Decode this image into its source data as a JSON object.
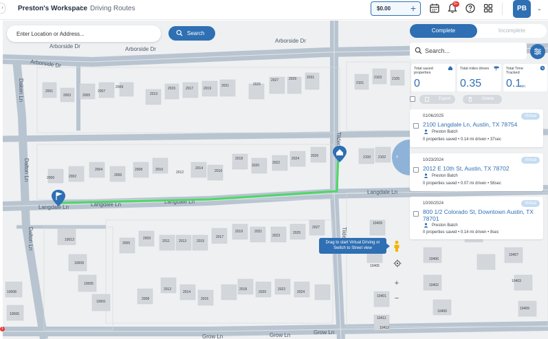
{
  "header": {
    "workspace": "Preston's Workspace",
    "separator": ">",
    "page": "Driving Routes",
    "balance": "$0.00",
    "notification_badge": "9+",
    "avatar_initials": "PB"
  },
  "search": {
    "placeholder": "Enter Location or Address...",
    "button_label": "Search"
  },
  "panel": {
    "tabs": [
      "Complete",
      "Incomplete"
    ],
    "active_tab": "Complete",
    "search_placeholder": "Search...",
    "stats": [
      {
        "label": "Total saved properties",
        "value": "0",
        "unit": "",
        "icon": "home-icon"
      },
      {
        "label": "Total miles driven",
        "value": "0.35",
        "unit": "",
        "icon": "signpost-icon"
      },
      {
        "label": "Total Time Tracked",
        "value": "0.1",
        "unit": "min",
        "icon": "clock-icon"
      }
    ],
    "actions": {
      "export_label": "Export",
      "delete_label": "Delete"
    },
    "routes": [
      {
        "date": "01/06/2025",
        "badge": "Virtual",
        "address": "2100 Langdale Ln, Austin, TX 78754",
        "owner": "Preston Batch",
        "properties": "0 properties saved",
        "miles": "0.14 mi driven",
        "duration": "37sec"
      },
      {
        "date": "10/23/2024",
        "badge": "Virtual",
        "address": "2012 E 10th St, Austin, TX 78702",
        "owner": "Preston Batch",
        "properties": "0 properties saved",
        "miles": "0.07 mi driven",
        "duration": "58sec"
      },
      {
        "date": "10/30/2024",
        "badge": "Virtual",
        "address": "800 1/2 Colorado St, Downtown Austin, TX 78701",
        "owner": "Preston Batch",
        "properties": "0 properties saved",
        "miles": "0.14 mi driven",
        "duration": "8sec"
      }
    ]
  },
  "map": {
    "tooltip": "Drag to start Virtual Driving or Switch to Street view",
    "streets": [
      "Arborside Dr",
      "Arborside Dr",
      "Arborside Dr",
      "Arborside Dr",
      "Langdale Ln",
      "Langdale Ln",
      "Langdale Ln",
      "Langdale Ln",
      "Grow Ln",
      "Grow Ln",
      "Grow Ln",
      "Tilden Ave",
      "Tilden Ave",
      "Dalton Ln",
      "Dalton Ln",
      "Daken Ln"
    ],
    "house_numbers_row1": [
      "2001",
      "2003",
      "2005",
      "2007",
      "2009",
      "2013",
      "2015",
      "2017",
      "2019",
      "2021",
      "2025",
      "2027",
      "2029",
      "2031"
    ],
    "house_numbers_row2": [
      "2000",
      "2002",
      "2004",
      "2006",
      "2008",
      "2010",
      "2012",
      "2014",
      "2016",
      "2018",
      "2020",
      "2022",
      "2024",
      "2026"
    ],
    "house_numbers_row3": [
      "2005",
      "2009",
      "2011",
      "2013",
      "2015",
      "2017",
      "2019",
      "2021",
      "2023",
      "2025",
      "2027"
    ],
    "house_numbers_row4": [
      "2008",
      "2012",
      "2014",
      "2016",
      "2018",
      "2020",
      "2022",
      "2024"
    ],
    "house_numbers_left": [
      "10013",
      "10009",
      "10005",
      "10001",
      "10008",
      "10006"
    ],
    "house_numbers_right": [
      "2100",
      "2102",
      "2101",
      "2103",
      "2105",
      "10409",
      "10405",
      "10401",
      "10406",
      "10402",
      "10404",
      "10400",
      "10407",
      "10403",
      "10409",
      "10411",
      "10413"
    ],
    "error_count": "1",
    "colors": {
      "route": "#4cd964",
      "pin": "#2f6fb3",
      "roads": "#b8c4d0",
      "accent": "#2f6fb3"
    }
  }
}
